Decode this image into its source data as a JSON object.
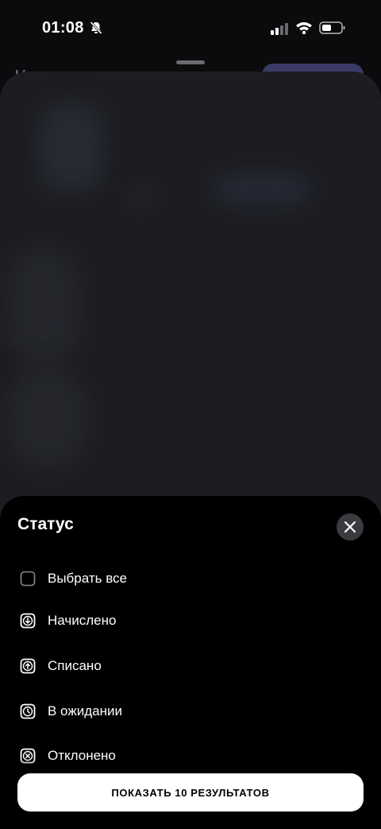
{
  "status_bar": {
    "time": "01:08",
    "icons": [
      "bell-slash-icon",
      "cellular-signal-icon",
      "wifi-icon",
      "battery-icon"
    ]
  },
  "background": {
    "title_stub": "К"
  },
  "filter_sheet": {
    "title": "Статус",
    "close_icon": "close-icon",
    "options": [
      {
        "label": "Выбрать все",
        "icon": "checkbox-empty-icon"
      },
      {
        "label": "Начислено",
        "icon": "arrow-down-square-icon"
      },
      {
        "label": "Списано",
        "icon": "arrow-up-square-icon"
      },
      {
        "label": "В ожидании",
        "icon": "clock-square-icon"
      },
      {
        "label": "Отклонено",
        "icon": "x-square-icon"
      }
    ],
    "show_results_label": "ПОКАЗАТЬ 10 РЕЗУЛЬТАТОВ"
  },
  "colors": {
    "sheet_background": "#000000",
    "underlying_sheet": "#1c1d21",
    "primary_button": "#ffffff",
    "close_button_bg": "#3a3b40"
  }
}
